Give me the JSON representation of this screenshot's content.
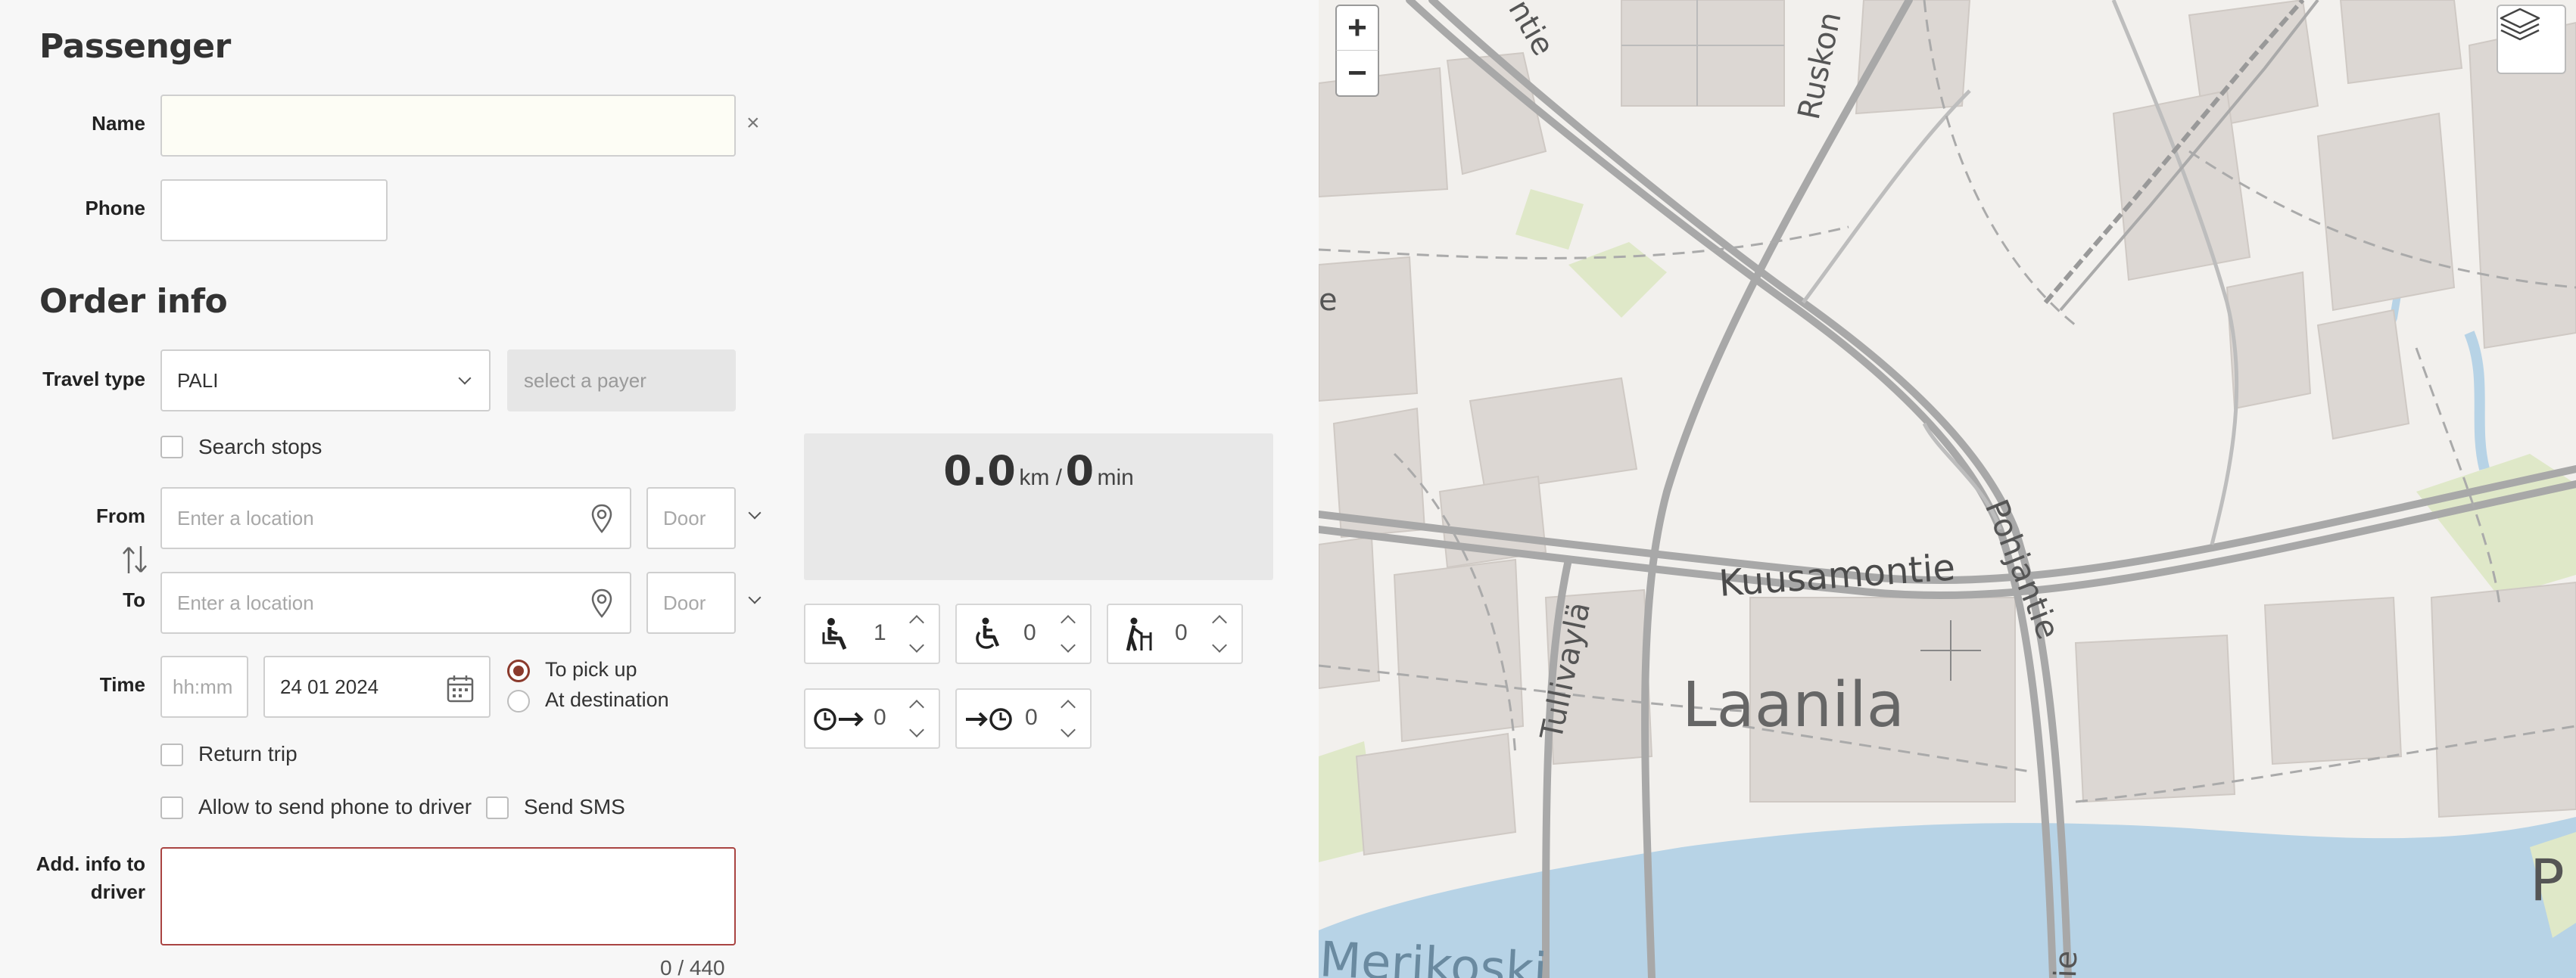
{
  "passenger": {
    "title": "Passenger",
    "name_label": "Name",
    "name_value": "",
    "clear_icon": "×",
    "phone_label": "Phone",
    "phone_value": ""
  },
  "order": {
    "title": "Order info",
    "travel_type_label": "Travel type",
    "travel_type_value": "PALI",
    "payer_placeholder": "select a payer",
    "search_stops_label": "Search stops",
    "from_label": "From",
    "to_label": "To",
    "location_placeholder": "Enter a location",
    "door_placeholder": "Door",
    "time_label": "Time",
    "time_placeholder": "hh:mm",
    "date_value": "24 01 2024",
    "to_pick_up_label": "To pick up",
    "at_destination_label": "At destination",
    "return_trip_label": "Return trip",
    "allow_phone_label": "Allow to send phone to driver",
    "send_sms_label": "Send SMS",
    "add_info_label_1": "Add. info to",
    "add_info_label_2": "driver",
    "add_info_value": "",
    "char_counter": "0 / 440"
  },
  "summary": {
    "distance": "0.0",
    "distance_unit": "km /",
    "duration": "0",
    "duration_unit": "min"
  },
  "counters": {
    "seated": "1",
    "wheelchair": "0",
    "walker": "0",
    "wait_before": "0",
    "wait_after": "0"
  },
  "map": {
    "zoom_in": "+",
    "zoom_out": "−",
    "labels": {
      "kuusamontie": "Kuusamontie",
      "laanila": "Laanila",
      "pohjantie": "Pohjantie",
      "tullivayla": "Tullivaylä",
      "ruskon": "Ruskon",
      "merikoski": "Merikoski",
      "ntie": "ntie",
      "ie": "ie",
      "p": "P",
      "e": "e"
    },
    "colors": {
      "water": "#b7d3e6",
      "building": "#dcd7d3",
      "green": "#dfe8c8",
      "road": "#a8a8a8",
      "background": "#f2f0ed"
    }
  }
}
